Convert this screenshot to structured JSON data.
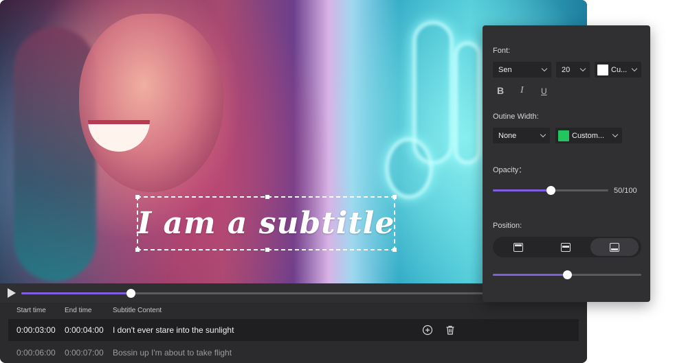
{
  "subtitle_preview": {
    "text": "I am a subtitle"
  },
  "playback": {
    "progress": 0.235
  },
  "table": {
    "headers": {
      "start": "Start time",
      "end": "End time",
      "content": "Subtitle Content"
    },
    "rows": [
      {
        "start": "0:00:03:00",
        "end": "0:00:04:00",
        "content": "I don't ever stare into the sunlight",
        "active": true
      },
      {
        "start": "0:00:06:00",
        "end": "0:00:07:00",
        "content": "Bossin up I'm about to take flight",
        "active": false
      }
    ],
    "row_icons": [
      "add-circle-icon",
      "trash-icon"
    ]
  },
  "panel": {
    "font_label": "Font:",
    "font_family": "Sen",
    "font_size": "20",
    "font_color_label": "Cu...",
    "font_color": "#ffffff",
    "format_icons": [
      "bold-icon",
      "italic-icon",
      "underline-icon"
    ],
    "format_glyphs": {
      "bold": "B",
      "italic": "I",
      "underline": "U"
    },
    "outline_label": "Outine Width:",
    "outline_width": "None",
    "outline_color_label": "Custom...",
    "outline_color": "#22c55e",
    "opacity_label": "Opacity：",
    "opacity_value": "50/100",
    "opacity_fraction": 0.5,
    "position_label": "Position:",
    "position_options": [
      "top",
      "middle",
      "bottom"
    ],
    "position_selected": "bottom",
    "position_offset_fraction": 0.5
  },
  "colors": {
    "accent": "#7f5ee0",
    "panel_bg": "#303033",
    "field_bg": "#252527"
  }
}
